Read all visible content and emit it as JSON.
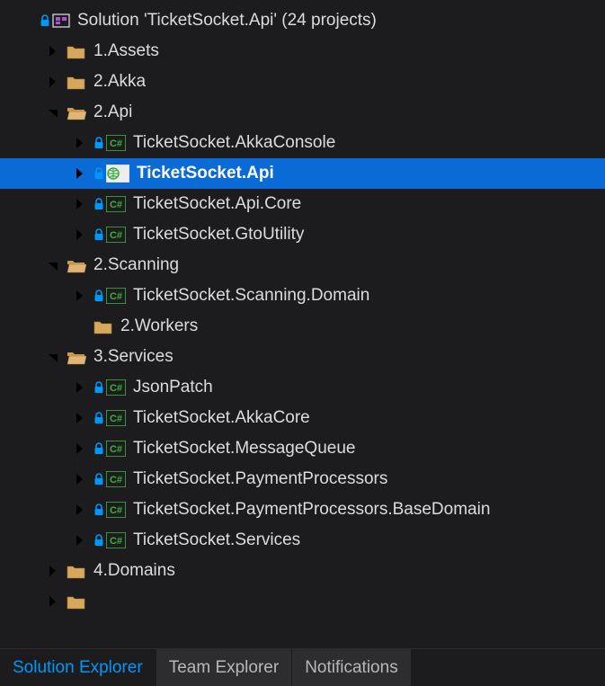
{
  "solution": {
    "name": "Solution 'TicketSocket.Api' (24 projects)"
  },
  "tree": [
    {
      "depth": 0,
      "chev": "none",
      "iconType": "solution",
      "label_path": "solution.name"
    },
    {
      "depth": 1,
      "chev": "right",
      "iconType": "folder-closed",
      "label": "1.Assets"
    },
    {
      "depth": 1,
      "chev": "right",
      "iconType": "folder-closed",
      "label": "2.Akka"
    },
    {
      "depth": 1,
      "chev": "down",
      "iconType": "folder-open",
      "label": "2.Api"
    },
    {
      "depth": 2,
      "chev": "right",
      "iconType": "csproj",
      "label": "TicketSocket.AkkaConsole"
    },
    {
      "depth": 2,
      "chev": "right",
      "iconType": "webproj",
      "label": "TicketSocket.Api",
      "selected": true
    },
    {
      "depth": 2,
      "chev": "right",
      "iconType": "csproj",
      "label": "TicketSocket.Api.Core"
    },
    {
      "depth": 2,
      "chev": "right",
      "iconType": "csproj",
      "label": "TicketSocket.GtoUtility"
    },
    {
      "depth": 1,
      "chev": "down",
      "iconType": "folder-open",
      "label": "2.Scanning"
    },
    {
      "depth": 2,
      "chev": "right",
      "iconType": "csproj",
      "label": "TicketSocket.Scanning.Domain"
    },
    {
      "depth": 2,
      "chev": "none",
      "iconType": "folder-closed",
      "label": "2.Workers"
    },
    {
      "depth": 1,
      "chev": "down",
      "iconType": "folder-open",
      "label": "3.Services"
    },
    {
      "depth": 2,
      "chev": "right",
      "iconType": "csproj",
      "label": "JsonPatch"
    },
    {
      "depth": 2,
      "chev": "right",
      "iconType": "csproj",
      "label": "TicketSocket.AkkaCore"
    },
    {
      "depth": 2,
      "chev": "right",
      "iconType": "csproj",
      "label": "TicketSocket.MessageQueue"
    },
    {
      "depth": 2,
      "chev": "right",
      "iconType": "csproj",
      "label": "TicketSocket.PaymentProcessors"
    },
    {
      "depth": 2,
      "chev": "right",
      "iconType": "csproj",
      "label": "TicketSocket.PaymentProcessors.BaseDomain"
    },
    {
      "depth": 2,
      "chev": "right",
      "iconType": "csproj",
      "label": "TicketSocket.Services"
    },
    {
      "depth": 1,
      "chev": "right",
      "iconType": "folder-closed",
      "label": "4.Domains"
    },
    {
      "depth": 1,
      "chev": "right",
      "iconType": "folder-closed",
      "label": ""
    }
  ],
  "tabs": [
    {
      "label": "Solution Explorer",
      "active": true
    },
    {
      "label": "Team Explorer",
      "active": false
    },
    {
      "label": "Notifications",
      "active": false
    }
  ],
  "colors": {
    "selectedBg": "#0a6bd6",
    "accent": "#0097fb",
    "csGreen": "#3fae3f",
    "lockBlue": "#0097fb",
    "folder": "#d7a75b"
  }
}
